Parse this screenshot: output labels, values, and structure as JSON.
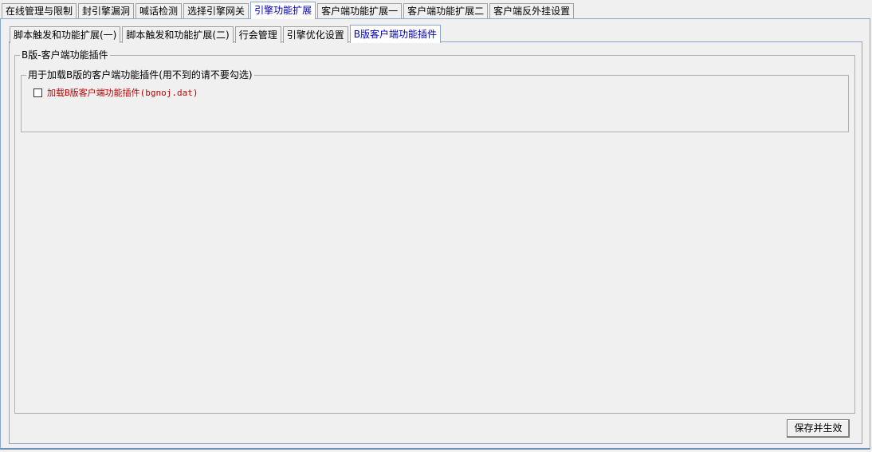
{
  "top_tabs": [
    {
      "label": "在线管理与限制",
      "active": false
    },
    {
      "label": "封引擎漏洞",
      "active": false
    },
    {
      "label": "喊话检测",
      "active": false
    },
    {
      "label": "选择引擎网关",
      "active": false
    },
    {
      "label": "引擎功能扩展",
      "active": true
    },
    {
      "label": "客户端功能扩展一",
      "active": false
    },
    {
      "label": "客户端功能扩展二",
      "active": false
    },
    {
      "label": "客户端反外挂设置",
      "active": false
    }
  ],
  "sub_tabs": [
    {
      "label": "脚本触发和功能扩展(一)",
      "active": false
    },
    {
      "label": "脚本触发和功能扩展(二)",
      "active": false
    },
    {
      "label": "行会管理",
      "active": false
    },
    {
      "label": "引擎优化设置",
      "active": false
    },
    {
      "label": "B版客户端功能插件",
      "active": true
    }
  ],
  "group_outer": {
    "legend": "B版-客户端功能插件"
  },
  "group_inner": {
    "legend": "用于加载B版的客户端功能插件(用不到的请不要勾选)"
  },
  "plugin_checkbox": {
    "label": "加载B版客户端功能插件(bgnoj.dat)",
    "checked": false
  },
  "save_button": {
    "label": "保存并生效"
  },
  "colors": {
    "active_tab_text": "#0000b8",
    "checkbox_label": "#c00000",
    "panel_border": "#8aa6c8"
  }
}
